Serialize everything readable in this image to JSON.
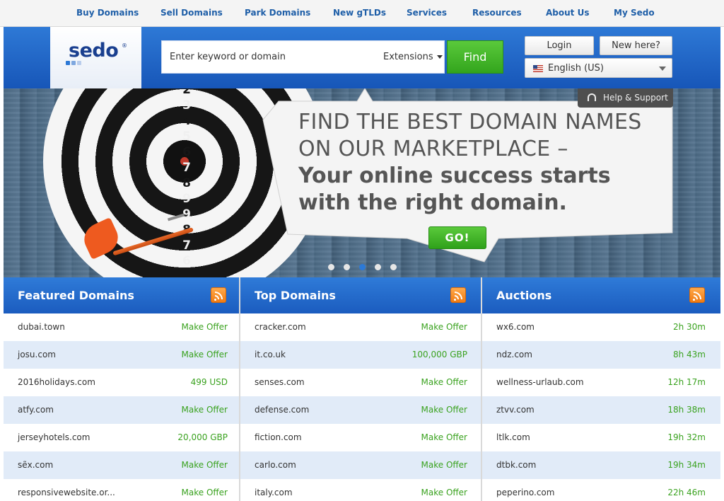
{
  "nav": {
    "items": [
      "Buy Domains",
      "Sell Domains",
      "Park Domains",
      "New gTLDs",
      "Services",
      "Resources",
      "About Us",
      "My Sedo"
    ]
  },
  "logo": {
    "text": "sedo",
    "reg": "®"
  },
  "search": {
    "placeholder": "Enter keyword or domain",
    "extensions_label": "Extensions",
    "find_label": "Find"
  },
  "account": {
    "login_label": "Login",
    "newhere_label": "New here?",
    "language": "English (US)"
  },
  "hero": {
    "help_label": "Help & Support",
    "line1": "FIND THE BEST DOMAIN NAMES",
    "line2": "ON OUR MARKETPLACE –",
    "line3": "Your online success starts",
    "line4": "with the right domain.",
    "go_label": "GO!",
    "target_numbers": [
      "2",
      "3",
      "4",
      "5",
      "6",
      "7",
      "8",
      "9",
      "9",
      "8",
      "7",
      "6"
    ],
    "slides": 5,
    "active_slide": 3
  },
  "colors": {
    "blue": "#1b5cbf",
    "green": "#3aa21f",
    "row_alt": "#e1ebf8",
    "rss": "#f07b12"
  },
  "featured": {
    "title": "Featured Domains",
    "rows": [
      {
        "name": "dubai.town",
        "value": "Make Offer"
      },
      {
        "name": "josu.com",
        "value": "Make Offer"
      },
      {
        "name": "2016holidays.com",
        "value": "499 USD"
      },
      {
        "name": "atfy.com",
        "value": "Make Offer"
      },
      {
        "name": "jerseyhotels.com",
        "value": "20,000 GBP"
      },
      {
        "name": "sẽx.com",
        "value": "Make Offer"
      },
      {
        "name": "responsivewebsite.or...",
        "value": "Make Offer"
      }
    ]
  },
  "top": {
    "title": "Top Domains",
    "rows": [
      {
        "name": "cracker.com",
        "value": "Make Offer"
      },
      {
        "name": "it.co.uk",
        "value": "100,000 GBP"
      },
      {
        "name": "senses.com",
        "value": "Make Offer"
      },
      {
        "name": "defense.com",
        "value": "Make Offer"
      },
      {
        "name": "fiction.com",
        "value": "Make Offer"
      },
      {
        "name": "carlo.com",
        "value": "Make Offer"
      },
      {
        "name": "italy.com",
        "value": "Make Offer"
      }
    ]
  },
  "auctions": {
    "title": "Auctions",
    "rows": [
      {
        "name": "wx6.com",
        "value": "2h 30m"
      },
      {
        "name": "ndz.com",
        "value": "8h 43m"
      },
      {
        "name": "wellness-urlaub.com",
        "value": "12h 17m"
      },
      {
        "name": "ztvv.com",
        "value": "18h 38m"
      },
      {
        "name": "ltlk.com",
        "value": "19h 32m"
      },
      {
        "name": "dtbk.com",
        "value": "19h 34m"
      },
      {
        "name": "peperino.com",
        "value": "22h 46m"
      }
    ]
  }
}
